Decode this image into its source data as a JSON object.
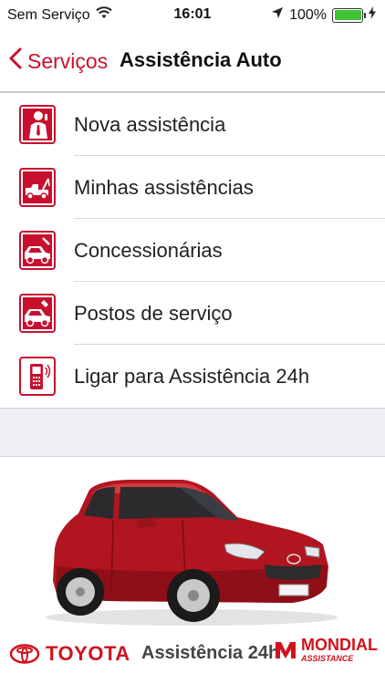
{
  "status_bar": {
    "carrier": "Sem Serviço",
    "time": "16:01",
    "battery": "100%",
    "battery_level": 1.0
  },
  "nav": {
    "back_label": "Serviços",
    "title": "Assistência Auto"
  },
  "menu": {
    "items": [
      {
        "label": "Nova assistência",
        "icon": "person-phone-icon"
      },
      {
        "label": "Minhas assistências",
        "icon": "tow-truck-icon"
      },
      {
        "label": "Concessionárias",
        "icon": "car-repair-icon"
      },
      {
        "label": "Postos de serviço",
        "icon": "car-service-icon"
      },
      {
        "label": "Ligar para Assistência 24h",
        "icon": "phone-call-icon"
      }
    ]
  },
  "footer": {
    "brand": "TOYOTA",
    "service": "Assistência 24h",
    "partner": "MONDIAL",
    "partner_sub": "ASSISTANCE"
  },
  "colors": {
    "accent": "#c8102e",
    "separator": "#d8d8d8",
    "band": "#efeff4"
  }
}
